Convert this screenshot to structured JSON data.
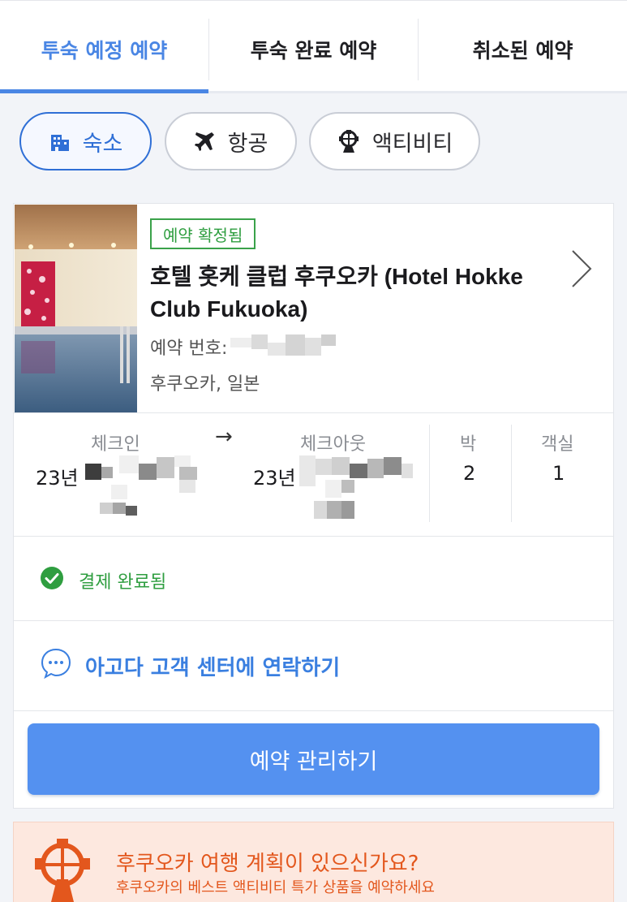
{
  "tabs": [
    {
      "label": "투숙 예정 예약",
      "active": true
    },
    {
      "label": "투숙 완료 예약",
      "active": false
    },
    {
      "label": "취소된 예약",
      "active": false
    }
  ],
  "filters": [
    {
      "label": "숙소",
      "icon": "building-icon",
      "active": true
    },
    {
      "label": "항공",
      "icon": "airplane-icon",
      "active": false
    },
    {
      "label": "액티비티",
      "icon": "ferris-wheel-icon",
      "active": false
    }
  ],
  "booking": {
    "status_badge": "예약 확정됨",
    "hotel_name": "호텔 홋케 클럽 후쿠오카 (Hotel Hokke Club Fukuoka)",
    "booking_number_label": "예약 번호:",
    "location": "후쿠오카, 일본",
    "checkin_label": "체크인",
    "checkin_value": "23년",
    "checkout_label": "체크아웃",
    "checkout_value": "23년",
    "nights_label": "박",
    "nights_value": "2",
    "rooms_label": "객실",
    "rooms_value": "1",
    "payment_status": "결제 완료됨",
    "contact_label": "아고다 고객 센터에 연락하기",
    "manage_button": "예약 관리하기"
  },
  "promo": {
    "title": "후쿠오카 여행 계획이 있으신가요?",
    "subtitle": "후쿠오카의 베스트 액티비티 특가 상품을 예약하세요"
  },
  "colors": {
    "accent": "#4a86e4",
    "success": "#2f9e40",
    "promo": "#e3571d",
    "button": "#5491f0"
  }
}
